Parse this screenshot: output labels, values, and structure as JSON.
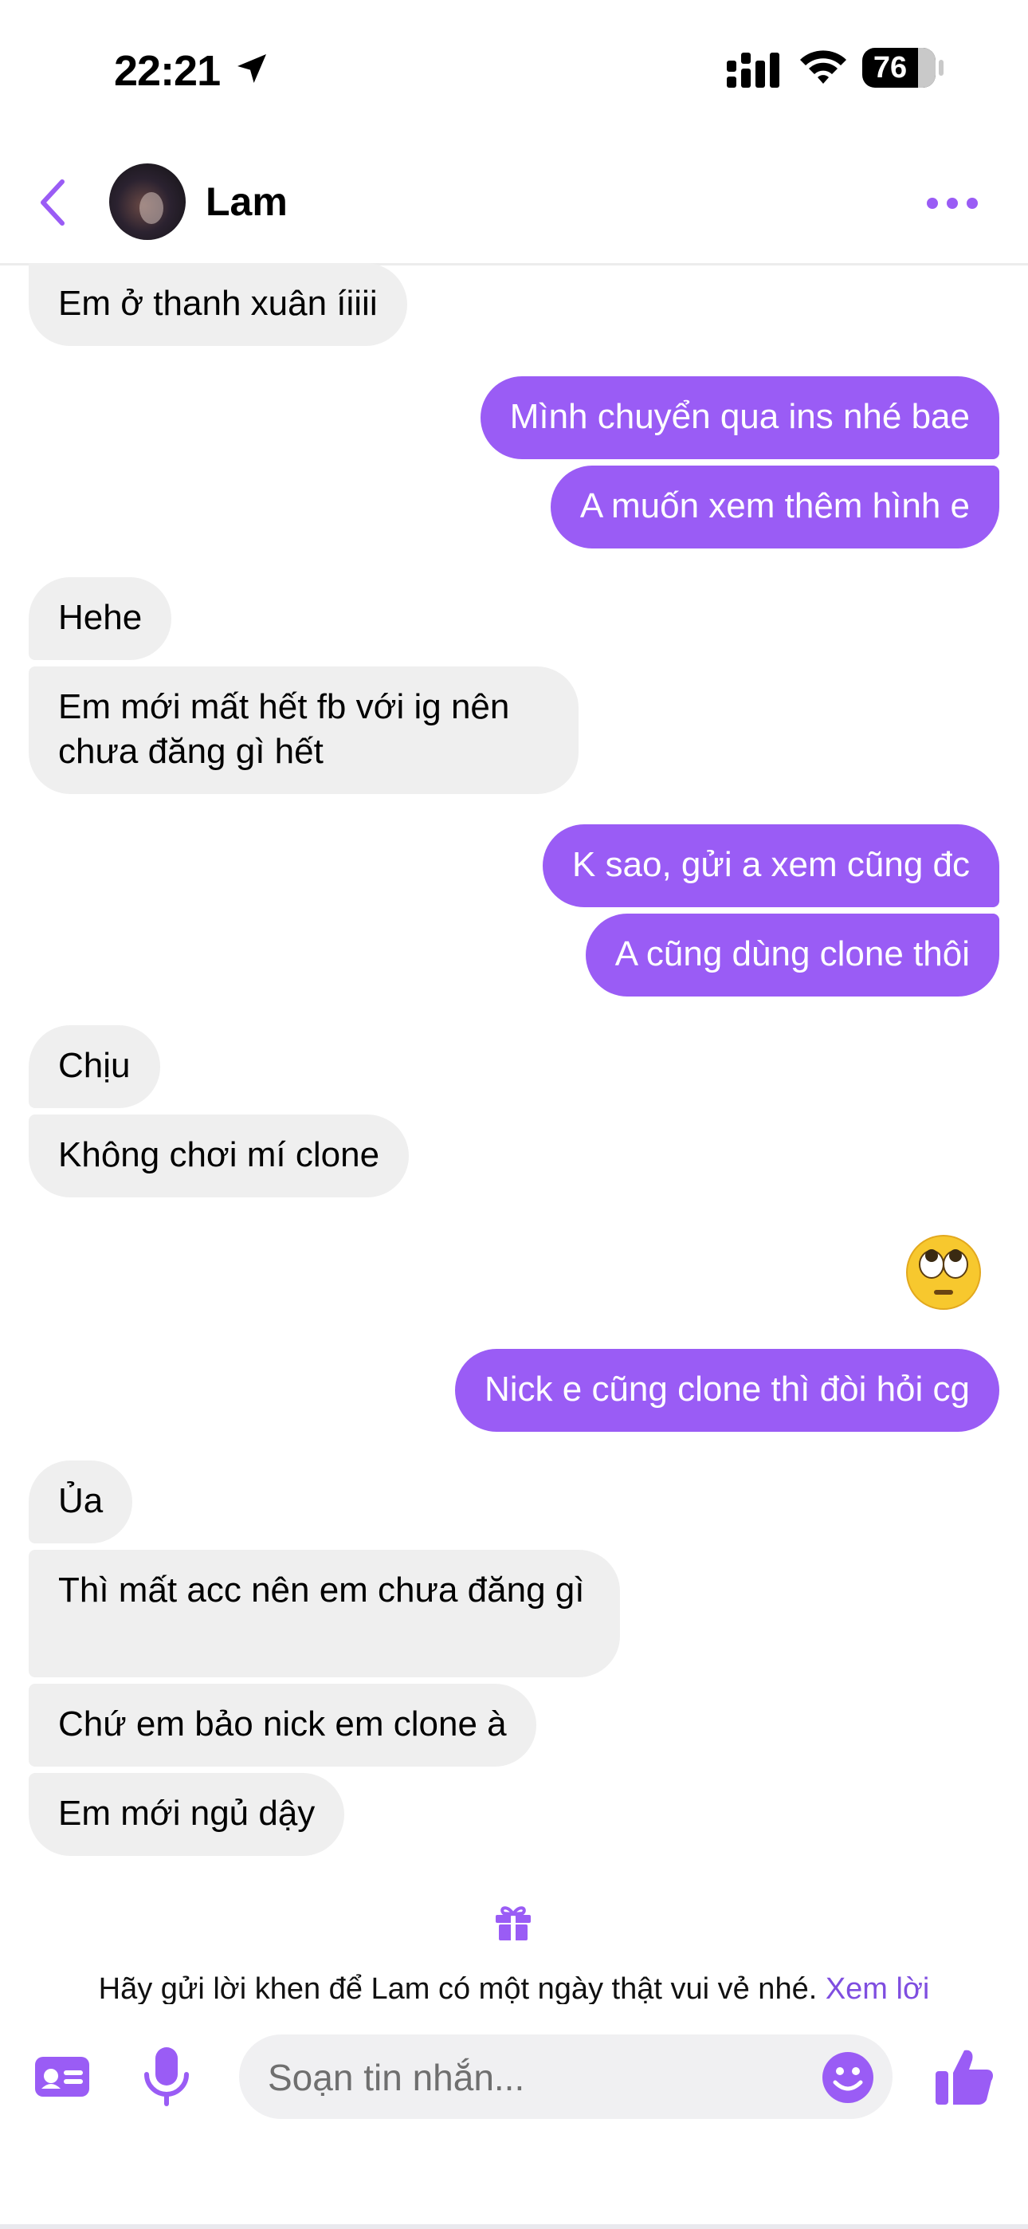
{
  "status_bar": {
    "time": "22:21",
    "battery": "76"
  },
  "header": {
    "contact_name": "Lam"
  },
  "messages": [
    {
      "side": "in",
      "text": "Em ở thanh xuân íiiii"
    },
    {
      "side": "out",
      "text": "Mình chuyển qua ins nhé bae"
    },
    {
      "side": "out",
      "text": "A muốn xem thêm hình e"
    },
    {
      "side": "in",
      "text": "Hehe"
    },
    {
      "side": "in",
      "text": "Em mới mất hết fb với ig nên chưa đăng gì hết"
    },
    {
      "side": "out",
      "text": "K sao, gửi a xem cũng đc"
    },
    {
      "side": "out",
      "text": "A cũng dùng clone thôi"
    },
    {
      "side": "in",
      "text": "Chịu"
    },
    {
      "side": "in",
      "text": "Không chơi mí clone"
    },
    {
      "side": "out",
      "text": "🙄",
      "type": "emoji",
      "icon": "face-with-rolling-eyes"
    },
    {
      "side": "out",
      "text": "Nick e cũng clone thì đòi hỏi cg"
    },
    {
      "side": "in",
      "text": "Ủa"
    },
    {
      "side": "in",
      "text": "Thì mất acc nên em chưa đăng gì"
    },
    {
      "side": "in",
      "text": "Chứ em bảo nick em clone à"
    },
    {
      "side": "in",
      "text": "Em mới ngủ dậy"
    }
  ],
  "prompt": {
    "text": "Hãy gửi lời khen để Lam có một ngày thật vui vẻ nhé.",
    "link": "Xem lời"
  },
  "composer": {
    "placeholder": "Soạn tin nhắn..."
  },
  "colors": {
    "accent": "#9a5cf5",
    "incoming_bubble": "#efefef",
    "link": "#7f4ee0"
  }
}
